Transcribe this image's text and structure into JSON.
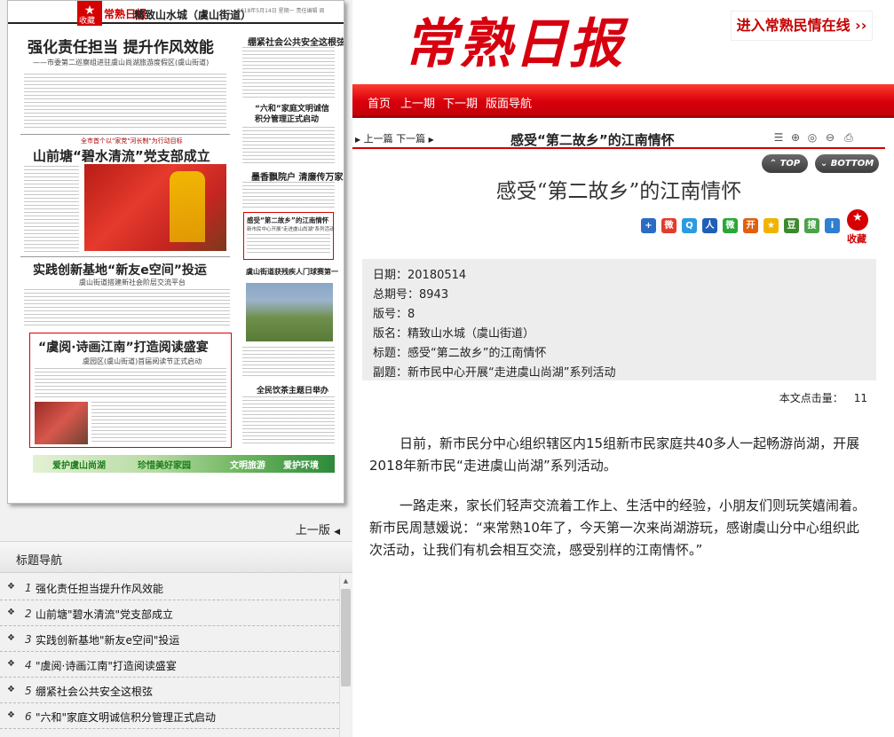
{
  "page_thumbnail": {
    "collect_label": "收藏",
    "logo": "常熟日报",
    "section": "精致山水城（虞山街道）",
    "meta": "2018年5月14日 星期一 责任编辑 周",
    "headline_1": "强化责任担当 提升作风效能",
    "sub_1": "——市委第二巡察组进驻虞山尚湖旅游度假区(虞山街道)",
    "kicker_2": "全市首个以\"家党\"河长制\"为行动目标",
    "headline_2": "山前塘“碧水清流”党支部成立",
    "headline_3": "实践创新基地“新友e空间”投运",
    "sub_3": "虞山街道搭建新社会阶层交流平台",
    "headline_4": "“虞阅·诗画江南”打造阅读盛宴",
    "sub_4": "虞园区(虞山街道)首届阅读节正式启动",
    "side_1": "绷紧社会公共安全这根弦",
    "side_2": "“六和”家庭文明诚信 积分管理正式启动",
    "side_3": "墨香飘院户 清廉传万家",
    "side_4": "感受“第二故乡”的江南情怀",
    "side_4_sub": "新市民中心开展\"走进虞山尚湖\"系列活动",
    "side_5": "虞山街道获残疾人门球赛第一",
    "side_6": "全民饮茶主题日举办",
    "banner_1": "爱护虞山尚湖",
    "banner_2": "珍惜美好家园",
    "banner_3": "文明旅游",
    "banner_4": "爱护环境"
  },
  "left_nav": {
    "prev_edition": "上一版",
    "section_title": "标题导航",
    "items": [
      {
        "num": "1",
        "title": "强化责任担当提升作风效能"
      },
      {
        "num": "2",
        "title": "山前塘\"碧水清流\"党支部成立"
      },
      {
        "num": "3",
        "title": "实践创新基地\"新友e空间\"投运"
      },
      {
        "num": "4",
        "title": "\"虞阅·诗画江南\"打造阅读盛宴"
      },
      {
        "num": "5",
        "title": "绷紧社会公共安全这根弦"
      },
      {
        "num": "6",
        "title": "\"六和\"家庭文明诚信积分管理正式启动"
      }
    ]
  },
  "header": {
    "logo": "常熟日报",
    "enter_link": "进入常熟民情在线 ››"
  },
  "nav": {
    "home": "首页",
    "prev_issue": "上一期",
    "next_issue": "下一期",
    "layout_nav": "版面导航"
  },
  "article_bar": {
    "prev": "上一篇",
    "next": "下一篇",
    "title": "感受“第二故乡”的江南情怀"
  },
  "buttons": {
    "top": "TOP",
    "bottom": "BOTTOM"
  },
  "article": {
    "title": "感受“第二故乡”的江南情怀",
    "collect_label": "收藏",
    "info": {
      "date_label": "日期：",
      "date": "20180514",
      "total_label": "总期号：",
      "total": "8943",
      "page_label": "版号：",
      "page": "8",
      "section_label": "版名：",
      "section": "精致山水城（虞山街道）",
      "title_label": "标题：",
      "title": "感受“第二故乡”的江南情怀",
      "subtitle_label": "副题：",
      "subtitle": "新市民中心开展“走进虞山尚湖”系列活动"
    },
    "hits_label": "本文点击量：",
    "hits": "11",
    "paragraphs": [
      "日前，新市民分中心组织辖区内15组新市民家庭共40多人一起畅游尚湖，开展2018年新市民“走进虞山尚湖”系列活动。",
      "一路走来，家长们轻声交流着工作上、生活中的经验，小朋友们则玩笑嬉闹着。新市民周慧媛说：“来常熟10年了，今天第一次来尚湖游玩，感谢虞山分中心组织此次活动，让我们有机会相互交流，感受别样的江南情怀。”"
    ]
  },
  "share_icons": [
    "add-icon",
    "weibo-icon",
    "tqq-icon",
    "renren-icon",
    "wechat-icon",
    "kaixin-icon",
    "qzone-icon",
    "douban-icon",
    "sohu-icon",
    "more-icon"
  ],
  "colors": {
    "brand_red": "#d7000f",
    "nav_red": "#d8000c"
  }
}
